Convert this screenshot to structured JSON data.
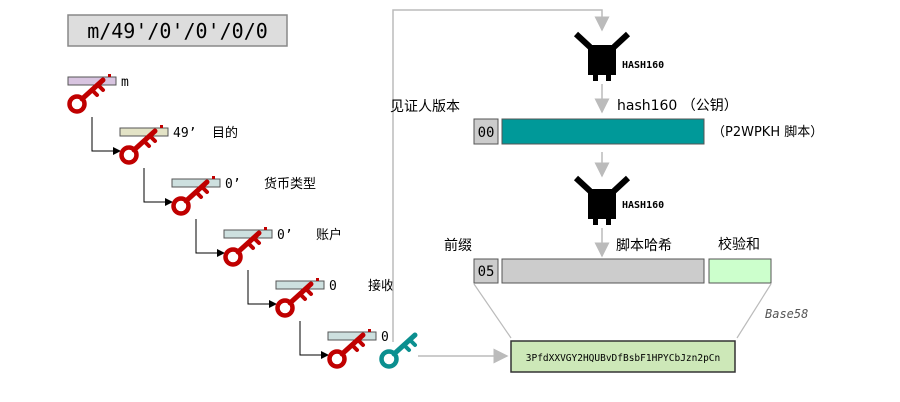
{
  "path_label": "m/49'/0'/0'/0/0",
  "hierarchy": [
    {
      "index": "m",
      "desc": "",
      "color": "#d8c4e0"
    },
    {
      "index": "49’",
      "desc": "目的",
      "color": "#e3e3c6"
    },
    {
      "index": "0’",
      "desc": "货币类型",
      "color": "#cde0df"
    },
    {
      "index": "0’",
      "desc": "账户",
      "color": "#cde0df"
    },
    {
      "index": "0",
      "desc": "接收",
      "color": "#cde0df"
    },
    {
      "index": "0",
      "desc": "",
      "color": "#cde0df"
    }
  ],
  "hash_top_label": "HASH160",
  "hash_bottom_label": "HASH160",
  "witness_version_label": "见证人版本",
  "hash160_pubkey_label": "hash160 （公钥）",
  "witness_version_value": "00",
  "p2wpkh_label": "（P2WPKH 脚本）",
  "prefix_label": "前缀",
  "prefix_value": "05",
  "script_hash_label": "脚本哈希",
  "checksum_label": "校验和",
  "base58_label": "Base58",
  "address_value": "3PfdXXVGY2HQUBvDfBsbF1HPYCbJzn2pCn",
  "colors": {
    "teal": "#009999",
    "key_red": "#c00000",
    "key_teal": "#0b8f8f",
    "checksum_green": "#ccffcc",
    "address_green": "#cde8b8",
    "gray_box": "#cccccc",
    "arrow_gray": "#bbbbbb"
  }
}
